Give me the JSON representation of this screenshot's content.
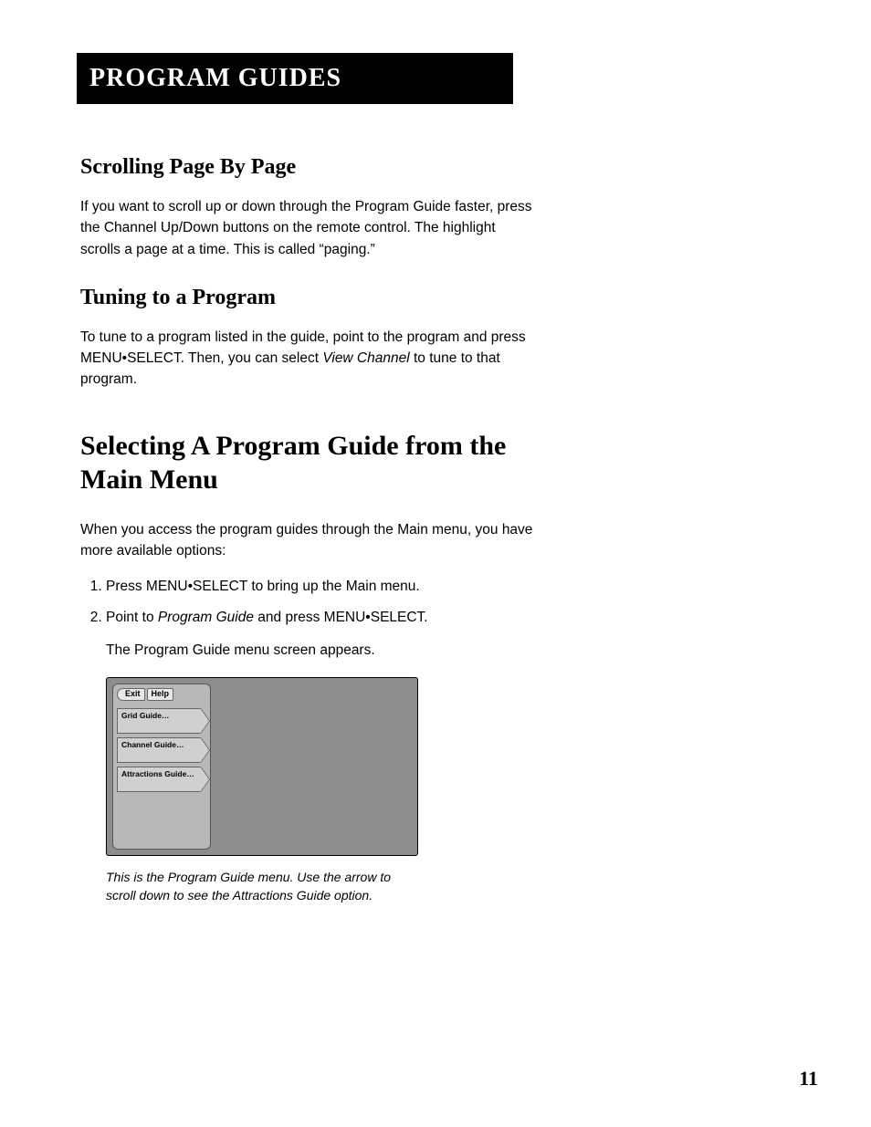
{
  "header": {
    "title": "PROGRAM GUIDES"
  },
  "section1": {
    "heading": "Scrolling Page By Page",
    "body": "If you want to scroll up or down through the Program Guide faster, press the Channel Up/Down buttons on the remote control. The highlight scrolls a page at a time. This is called “paging.”"
  },
  "section2": {
    "heading": "Tuning to a Program",
    "body_a": "To tune to a program listed in the guide, point to the program and press MENU•SELECT. Then, you can select ",
    "body_em": "View Channel",
    "body_b": " to tune to that program."
  },
  "section3": {
    "heading": "Selecting A Program Guide from the Main Menu",
    "intro": "When you access the program guides through the Main menu, you have more available options:",
    "step1": "Press MENU•SELECT to bring up the Main menu.",
    "step2_a": "Point to ",
    "step2_em": "Program Guide",
    "step2_b": " and press MENU•SELECT.",
    "after": "The Program Guide menu screen appears."
  },
  "screenshot": {
    "tab_exit": "Exit",
    "tab_help": "Help",
    "item1": "Grid Guide…",
    "item2": "Channel Guide…",
    "item3": "Attractions Guide…",
    "caption": "This is the Program Guide menu. Use the arrow to scroll down to see the Attractions Guide option."
  },
  "page_number": "11"
}
